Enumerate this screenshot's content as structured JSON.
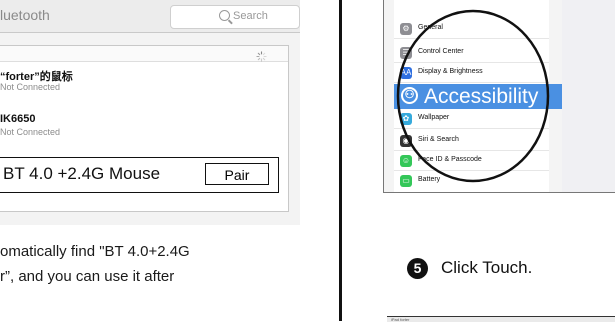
{
  "bluetooth": {
    "title": "luetooth",
    "search_placeholder": "Search",
    "devices": [
      {
        "name": "“forter”的鼠标",
        "status": "Not Connected"
      },
      {
        "name": "IK6650",
        "status": "Not Connected"
      }
    ],
    "callout_device": "BT 4.0 +2.4G  Mouse",
    "pair_label": "Pair",
    "list_header": ""
  },
  "instructions": {
    "line1": "omatically find \"BT 4.0+2.4G",
    "line2": "r”, and you can use it after"
  },
  "ios_settings": {
    "items": [
      {
        "label": "General",
        "icon": "gear-icon",
        "glyph": "⚙",
        "color": "#8e8e93"
      },
      {
        "label": "Control Center",
        "icon": "toggles-icon",
        "glyph": "☰",
        "color": "#8e8e93"
      },
      {
        "label": "Display & Brightness",
        "icon": "brightness-icon",
        "glyph": "AA",
        "color": "#2f6fe0"
      }
    ],
    "highlight": {
      "label": "Accessibility",
      "icon": "accessibility-icon",
      "glyph": "⚇"
    },
    "items_after": [
      {
        "label": "Wallpaper",
        "icon": "wallpaper-icon",
        "glyph": "✿",
        "color": "#36aadc"
      },
      {
        "label": "Siri & Search",
        "icon": "siri-icon",
        "glyph": "◉",
        "color": "#333333"
      },
      {
        "label": "Face ID & Passcode",
        "icon": "faceid-icon",
        "glyph": "☺",
        "color": "#34c759"
      },
      {
        "label": "Battery",
        "icon": "battery-icon",
        "glyph": "▭",
        "color": "#34c759"
      }
    ],
    "highlight_color": "#4a90e2"
  },
  "step": {
    "number": "5",
    "text": "Click Touch."
  },
  "next_preview": {
    "text": "iPad  forter"
  }
}
